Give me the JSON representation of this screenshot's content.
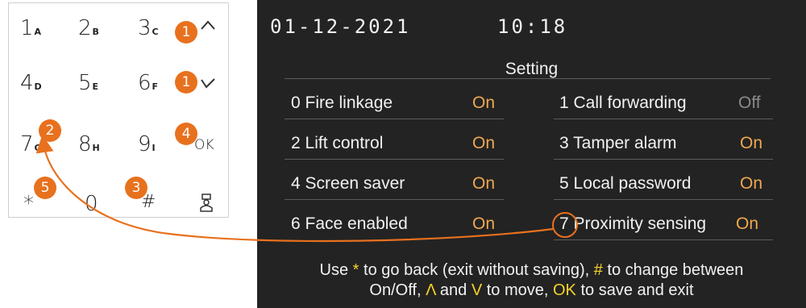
{
  "keypad": {
    "keys": [
      {
        "digit": "1",
        "sub": "A"
      },
      {
        "digit": "2",
        "sub": "B"
      },
      {
        "digit": "3",
        "sub": "C"
      },
      {
        "digit": "4",
        "sub": "D"
      },
      {
        "digit": "5",
        "sub": "E"
      },
      {
        "digit": "6",
        "sub": "F"
      },
      {
        "digit": "7",
        "sub": "G"
      },
      {
        "digit": "8",
        "sub": "H"
      },
      {
        "digit": "9",
        "sub": "I"
      },
      {
        "digit": "0",
        "sub": ""
      }
    ],
    "up_icon": "chevron-up-icon",
    "down_icon": "chevron-down-icon",
    "ok_label": "OK",
    "star_label": "*",
    "hash_label": "#",
    "bell_icon": "concierge-icon"
  },
  "markers": {
    "up": "1",
    "down": "1",
    "seven": "2",
    "hash": "3",
    "ok": "4",
    "star": "5"
  },
  "screen": {
    "date": "01-12-2021",
    "time": "10:18",
    "title": "Setting",
    "items": [
      {
        "label": "0 Fire linkage",
        "value": "On"
      },
      {
        "label": "1 Call forwarding",
        "value": "Off"
      },
      {
        "label": "2 Lift control",
        "value": "On"
      },
      {
        "label": "3 Tamper alarm",
        "value": "On"
      },
      {
        "label": "4 Screen saver",
        "value": "On"
      },
      {
        "label": "5 Local password",
        "value": "On"
      },
      {
        "label": "6 Face enabled",
        "value": "On"
      },
      {
        "label": "7 Proximity sensing",
        "value": "On"
      }
    ],
    "help": {
      "p1": "Use ",
      "star": "*",
      "p2": " to go back (exit without saving), ",
      "hash": "#",
      "p3": " to change between",
      "p4": "On/Off, ",
      "up": "Λ",
      "p5": " and ",
      "down": "V",
      "p6": " to move, ",
      "ok": "OK",
      "p7": " to save and exit"
    }
  },
  "colors": {
    "accent": "#e8711e",
    "on": "#f0a850",
    "off": "#8a8a8a",
    "highlight": "#f7d22b",
    "screen_bg": "#232323"
  }
}
